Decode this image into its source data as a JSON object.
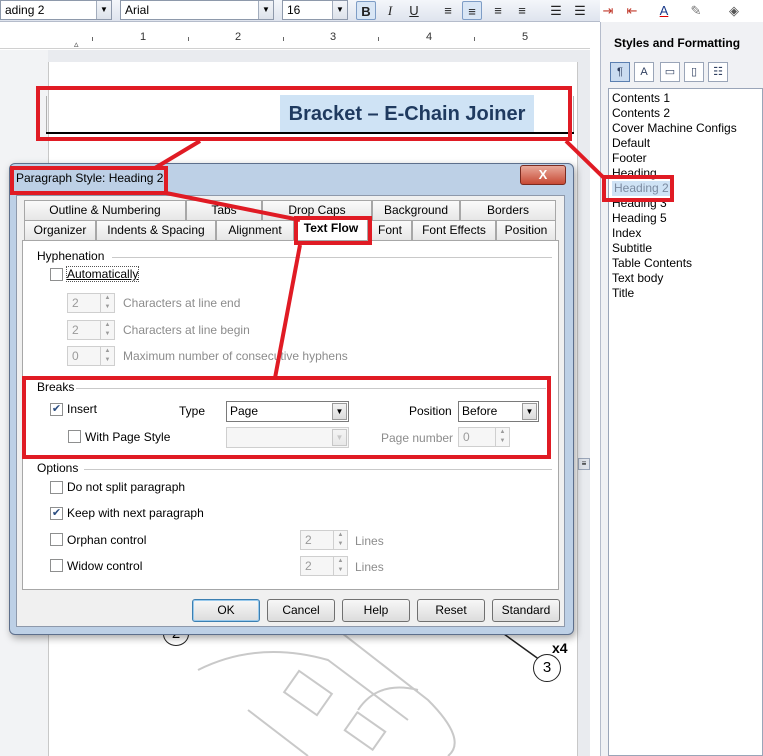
{
  "toolbar": {
    "style_value": "ading 2",
    "font_value": "Arial",
    "size_value": "16",
    "bold_label": "B",
    "italic_label": "I",
    "underline_label": "U"
  },
  "ruler": {
    "numbers": [
      "1",
      "2",
      "3",
      "4",
      "5"
    ]
  },
  "document": {
    "heading_text": "Bracket – E-Chain Joiner",
    "callout_2": "2",
    "callout_3": "3",
    "callout_x4": "x4"
  },
  "styles_panel": {
    "title": "Styles and Formatting",
    "items": [
      "Contents 1",
      "Contents 2",
      "Cover Machine Configs",
      "Default",
      "Footer",
      "Heading",
      "Heading 2",
      "Heading 3",
      "Heading 5",
      "Index",
      "Subtitle",
      "Table Contents",
      "Text body",
      "Title"
    ],
    "selected": "Heading 2"
  },
  "dialog": {
    "title": "Paragraph Style: Heading 2",
    "close_label": "X",
    "tabs_row1": [
      "Outline & Numbering",
      "Tabs",
      "Drop Caps",
      "Background",
      "Borders"
    ],
    "tabs_row2": [
      "Organizer",
      "Indents & Spacing",
      "Alignment",
      "Text Flow",
      "Font",
      "Font Effects",
      "Position"
    ],
    "active_tab": "Text Flow",
    "hyphenation": {
      "section": "Hyphenation",
      "automatically": "Automatically",
      "chars_end_value": "2",
      "chars_end_label": "Characters at line end",
      "chars_begin_value": "2",
      "chars_begin_label": "Characters at line begin",
      "max_hyphens_value": "0",
      "max_hyphens_label": "Maximum number of consecutive hyphens"
    },
    "breaks": {
      "section": "Breaks",
      "insert_label": "Insert",
      "insert_checked": true,
      "type_label": "Type",
      "type_value": "Page",
      "position_label": "Position",
      "position_value": "Before",
      "page_style_label": "With Page Style",
      "page_number_label": "Page number",
      "page_number_value": "0"
    },
    "options": {
      "section": "Options",
      "do_not_split": "Do not split paragraph",
      "keep_with_next": "Keep with next paragraph",
      "orphan": "Orphan control",
      "orphan_value": "2",
      "widow": "Widow control",
      "widow_value": "2",
      "lines_label": "Lines"
    },
    "buttons": {
      "ok": "OK",
      "cancel": "Cancel",
      "help": "Help",
      "reset": "Reset",
      "standard": "Standard"
    }
  },
  "colors": {
    "annotation_red": "#e01b24",
    "selection_blue": "#cfe3f5",
    "heading_text": "#1f3a5f"
  }
}
